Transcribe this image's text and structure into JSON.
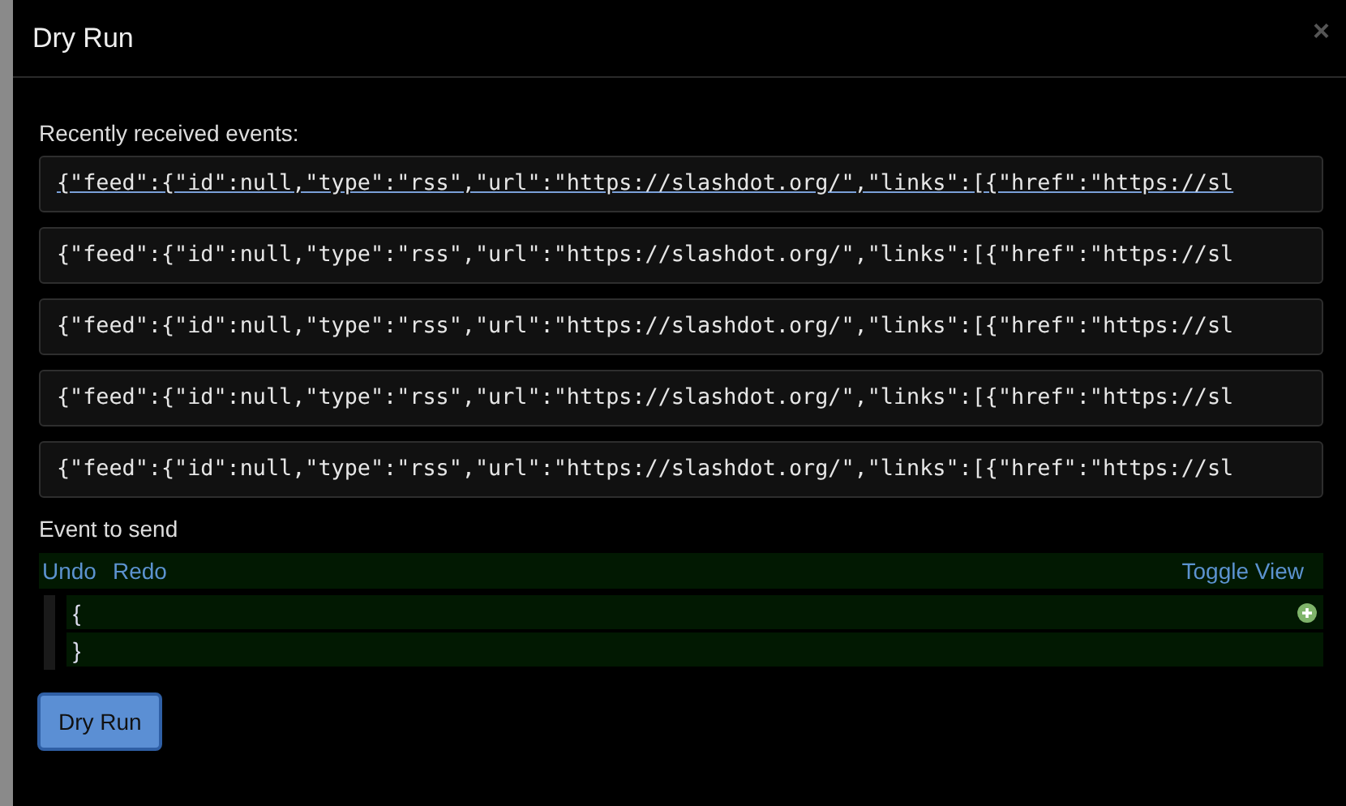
{
  "dialog": {
    "title": "Dry Run",
    "close": "×"
  },
  "received": {
    "label": "Recently received events:",
    "events": [
      {
        "text": "{\"feed\":{\"id\":null,\"type\":\"rss\",\"url\":\"https://slashdot.org/\",\"links\":[{\"href\":\"https://sl",
        "hovered": true
      },
      {
        "text": "{\"feed\":{\"id\":null,\"type\":\"rss\",\"url\":\"https://slashdot.org/\",\"links\":[{\"href\":\"https://sl",
        "hovered": false
      },
      {
        "text": "{\"feed\":{\"id\":null,\"type\":\"rss\",\"url\":\"https://slashdot.org/\",\"links\":[{\"href\":\"https://sl",
        "hovered": false
      },
      {
        "text": "{\"feed\":{\"id\":null,\"type\":\"rss\",\"url\":\"https://slashdot.org/\",\"links\":[{\"href\":\"https://sl",
        "hovered": false
      },
      {
        "text": "{\"feed\":{\"id\":null,\"type\":\"rss\",\"url\":\"https://slashdot.org/\",\"links\":[{\"href\":\"https://sl",
        "hovered": false
      }
    ]
  },
  "editor": {
    "label": "Event to send",
    "actions": [
      "Undo",
      "Redo"
    ],
    "toggle": "Toggle View",
    "lines": [
      "{",
      "}"
    ]
  },
  "buttons": [
    "Dry Run"
  ]
}
